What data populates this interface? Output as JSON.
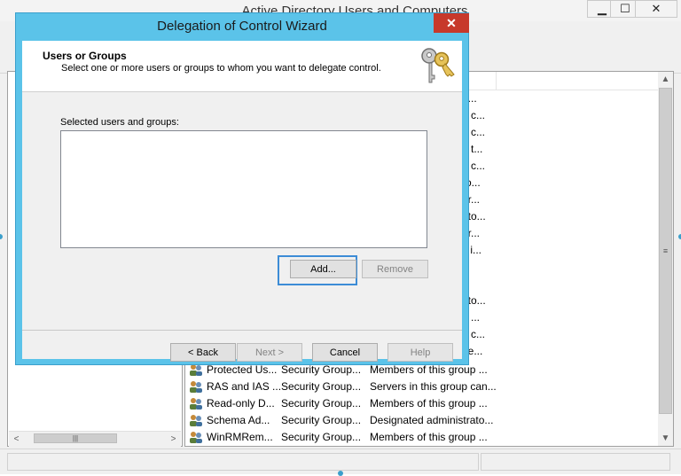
{
  "background_window": {
    "title": "Active Directory Users and Computers",
    "list_rows_partial": [
      "d...",
      "p c...",
      "p c...",
      "p t...",
      "p c...",
      "ro...",
      "er...",
      "ato...",
      "er...",
      "s i...",
      "",
      "",
      "ato...",
      "p ...",
      "p c...",
      "ue..."
    ],
    "list_rows": [
      {
        "name": "Protected Us...",
        "type": "Security Group...",
        "description": "Members of this group ..."
      },
      {
        "name": "RAS and IAS ...",
        "type": "Security Group...",
        "description": "Servers in this group can..."
      },
      {
        "name": "Read-only D...",
        "type": "Security Group...",
        "description": "Members of this group ..."
      },
      {
        "name": "Schema Ad...",
        "type": "Security Group...",
        "description": "Designated administrato..."
      },
      {
        "name": "WinRMRem...",
        "type": "Security Group...",
        "description": "Members of this group ..."
      }
    ]
  },
  "dialog": {
    "title": "Delegation of Control Wizard",
    "close_glyph": "✕",
    "header_title": "Users or Groups",
    "header_subtitle": "Select one or more users or groups to whom you want to delegate control.",
    "selected_label": "Selected users and groups:",
    "add_label": "Add...",
    "remove_label": "Remove",
    "back_label": "< Back",
    "next_label": "Next >",
    "cancel_label": "Cancel",
    "help_label": "Help"
  },
  "icons": {
    "minimize": "minimize-icon",
    "maximize": "maximize-icon",
    "close": "close-icon",
    "keys": "keys-icon",
    "group": "group-icon"
  },
  "colors": {
    "dialog_frame": "#5bc3e9",
    "focus_ring": "#3c8cd6",
    "close_button": "#c7392b"
  }
}
